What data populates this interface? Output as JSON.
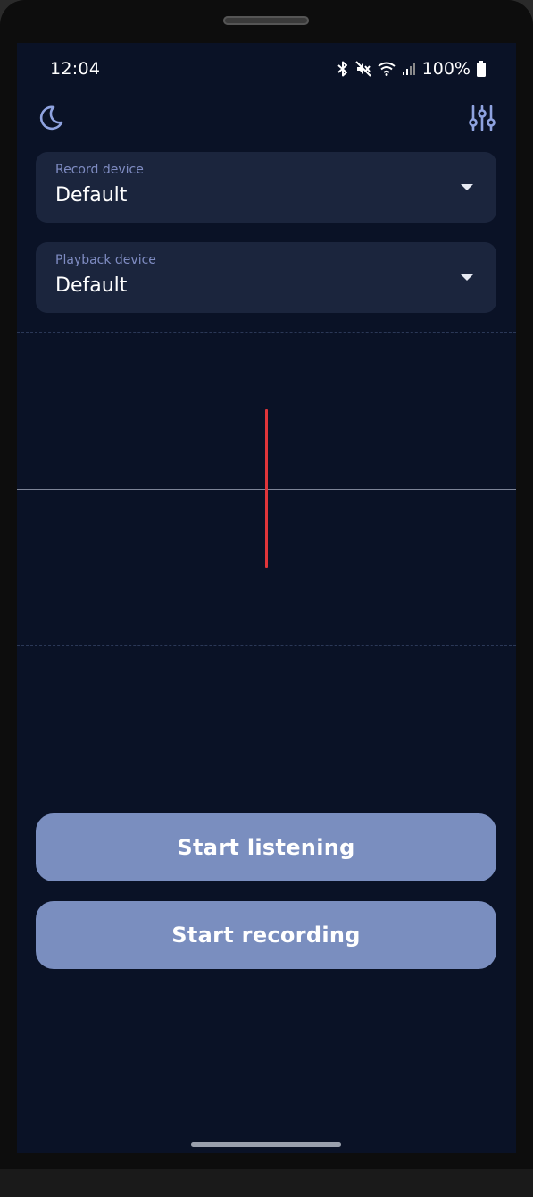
{
  "status_bar": {
    "time": "12:04",
    "battery": "100%",
    "icons": [
      "bluetooth-icon",
      "mute-icon",
      "wifi-icon",
      "signal-icon",
      "battery-icon"
    ]
  },
  "toolbar": {
    "left_icon": "moon-icon",
    "right_icon": "tune-sliders-icon"
  },
  "record_device": {
    "label": "Record device",
    "value": "Default"
  },
  "playback_device": {
    "label": "Playback device",
    "value": "Default"
  },
  "buttons": {
    "start_listening": "Start listening",
    "start_recording": "Start recording"
  },
  "colors": {
    "background": "#0a1226",
    "card": "#1b253d",
    "label": "#7f8cc2",
    "button": "#7a8ebf",
    "cursor": "#e0353a",
    "accent_icon": "#8fa3e0"
  }
}
